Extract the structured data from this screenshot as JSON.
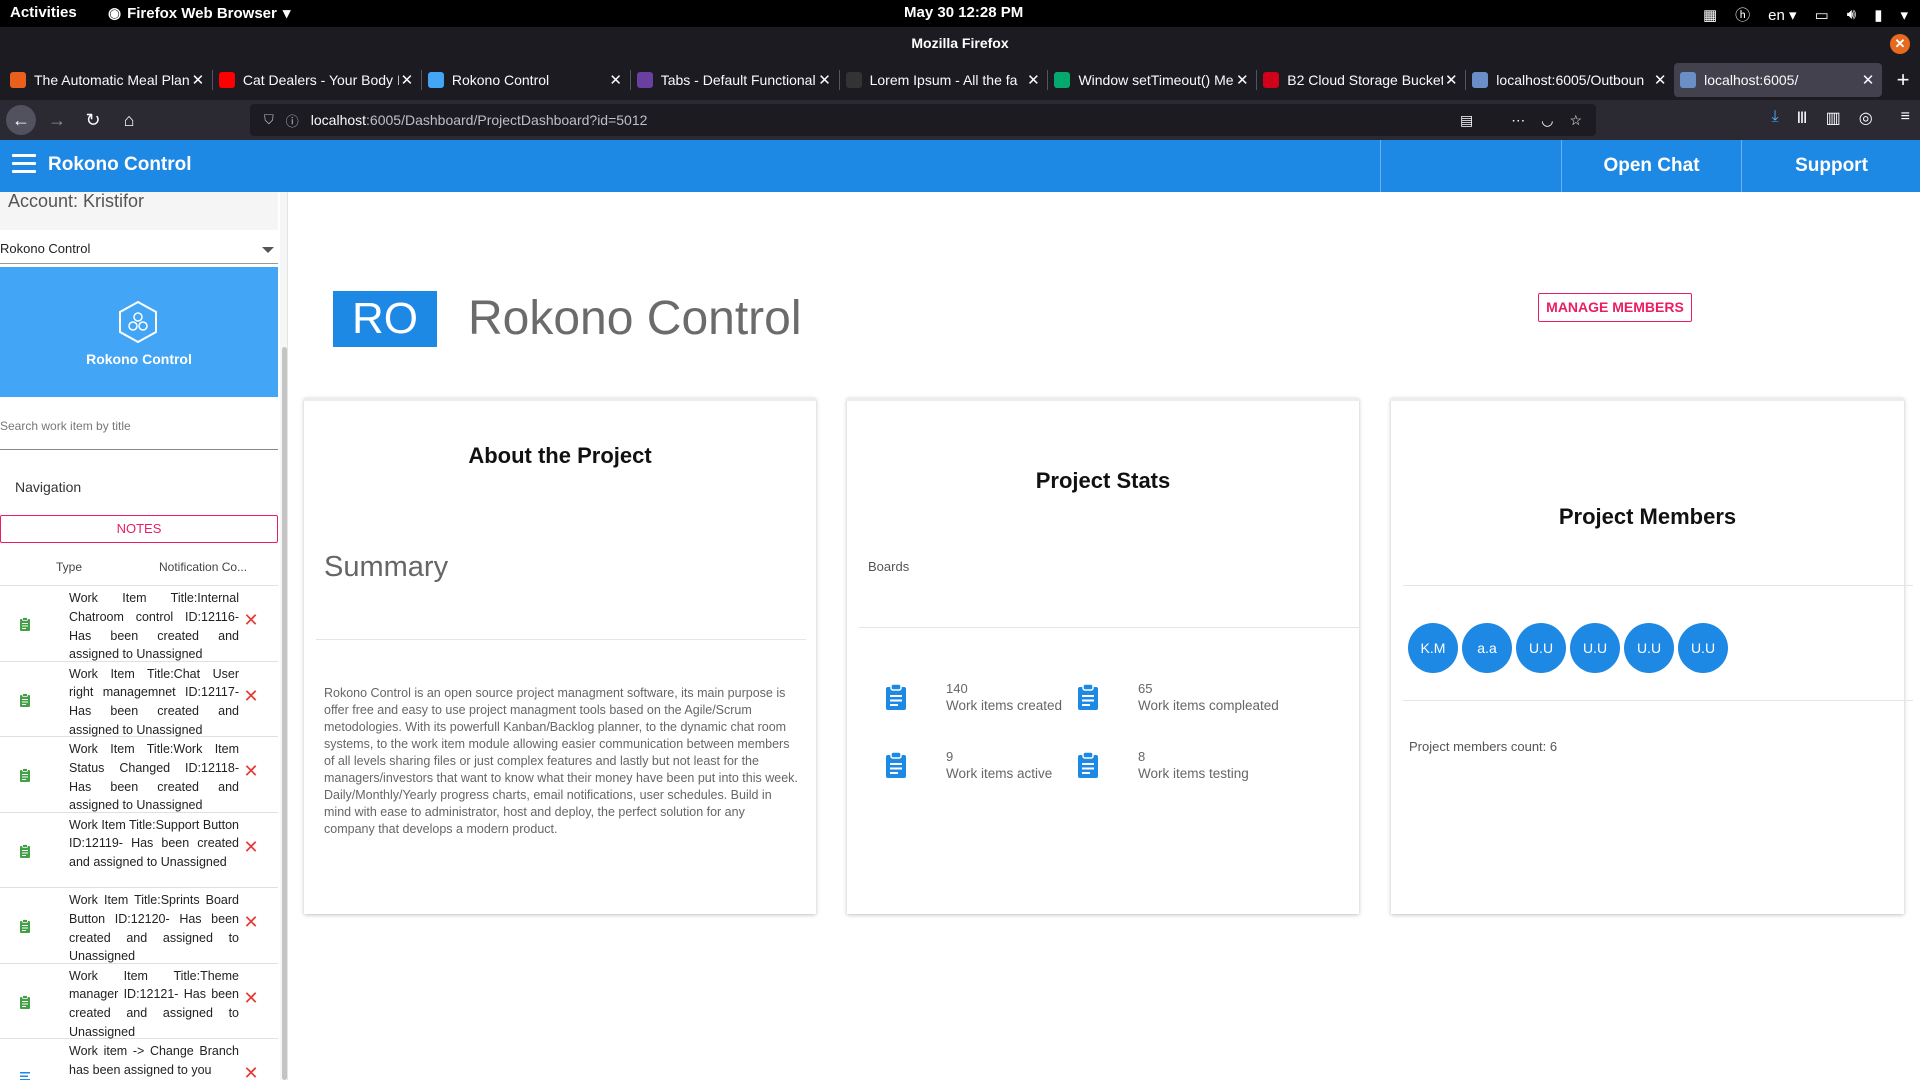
{
  "gnome": {
    "activities": "Activities",
    "app_name": "Firefox Web Browser",
    "clock": "May 30  12:28 PM",
    "lang": "en"
  },
  "window": {
    "title": "Mozilla Firefox"
  },
  "tabs": [
    {
      "title": "The Automatic Meal Plan",
      "color": "#e8601c",
      "active": false
    },
    {
      "title": "Cat Dealers - Your Body I",
      "color": "#ff0000",
      "active": false
    },
    {
      "title": "Rokono Control",
      "color": "#42a5f5",
      "active": false
    },
    {
      "title": "Tabs - Default Functional",
      "color": "#6b3fa0",
      "active": false
    },
    {
      "title": "Lorem Ipsum - All the fa",
      "color": "#333333",
      "active": false
    },
    {
      "title": "Window setTimeout() Me",
      "color": "#04aa6d",
      "active": false
    },
    {
      "title": "B2 Cloud Storage Bucket",
      "color": "#d0021b",
      "active": false
    },
    {
      "title": "localhost:6005/Outboun",
      "color": "#6a8fc7",
      "active": false
    },
    {
      "title": "localhost:6005/",
      "color": "#6a8fc7",
      "active": true
    }
  ],
  "url": {
    "host": "localhost",
    "path": ":6005/Dashboard/ProjectDashboard?id=5012"
  },
  "header": {
    "brand": "Rokono Control",
    "open_chat": "Open Chat",
    "support": "Support"
  },
  "sidebar": {
    "account": "Account: Kristifor",
    "project_select": "Rokono Control",
    "project_card_name": "Rokono Control",
    "search_placeholder": "Search work item by title",
    "navigation": "Navigation",
    "notes_button": "NOTES",
    "table_headers": {
      "type": "Type",
      "content": "Notification Co..."
    },
    "notifications": [
      {
        "text": "Work Item Title:Internal Chatroom control ID:12116- Has been created and assigned to Unassigned",
        "icon": "clipboard-icon"
      },
      {
        "text": "Work Item Title:Chat User right managemnet ID:12117- Has been created and assigned to Unassigned",
        "icon": "clipboard-icon"
      },
      {
        "text": "Work Item Title:Work Item Status Changed ID:12118- Has been created and assigned to Unassigned",
        "icon": "clipboard-icon"
      },
      {
        "text": "Work Item Title:Support Button ID:12119- Has been created and assigned to Unassigned",
        "icon": "clipboard-icon"
      },
      {
        "text": "Work Item Title:Sprints Board Button ID:12120- Has been created and assigned to Unassigned",
        "icon": "clipboard-icon"
      },
      {
        "text": "Work Item Title:Theme manager ID:12121- Has been created and assigned to Unassigned",
        "icon": "clipboard-icon"
      },
      {
        "text": "Work item -> Change Branch has been assigned to you",
        "icon": "list-icon"
      }
    ]
  },
  "project": {
    "badge": "RO",
    "title": "Rokono Control",
    "manage_members": "MANAGE MEMBERS"
  },
  "about": {
    "heading": "About the Project",
    "summary": "Summary",
    "description": "Rokono Control is an open source project managment software, its main purpose is offer free and easy to use project managment tools based on the Agile/Scrum metodologies. With its powerfull Kanban/Backlog planner, to the dynamic chat room systems, to the work item module allowing easier communication between members of all levels sharing files or just complex features and lastly but not least for the managers/investors that want to know what their money have been put into this week. Daily/Monthly/Yearly progress charts, email notifications, user schedules. Build in mind with ease to administrator, host and deploy, the perfect solution for any company that develops a modern product."
  },
  "stats": {
    "heading": "Project Stats",
    "boards_label": "Boards",
    "items": [
      {
        "num": "140",
        "label": "Work items created"
      },
      {
        "num": "65",
        "label": "Work items compleated"
      },
      {
        "num": "9",
        "label": "Work items active"
      },
      {
        "num": "8",
        "label": "Work items testing"
      }
    ]
  },
  "members": {
    "heading": "Project Members",
    "avatars": [
      "K.M",
      "a.a",
      "U.U",
      "U.U",
      "U.U",
      "U.U"
    ],
    "count_text": "Project members count: 6"
  },
  "colors": {
    "primary": "#1e88e5",
    "accent": "#e91e63",
    "sidebar_card": "#42a5f5"
  }
}
